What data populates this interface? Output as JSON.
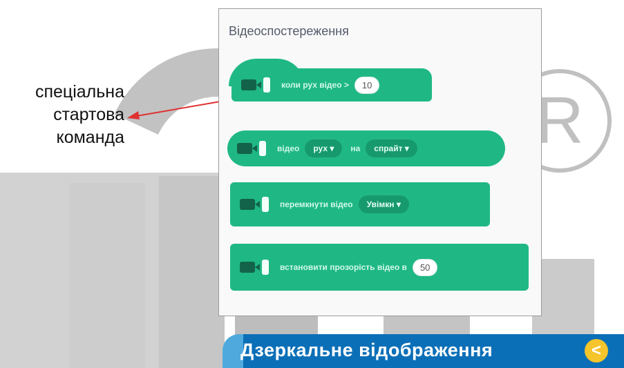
{
  "annotation": {
    "lines": [
      "спеціальна",
      "стартова",
      "команда"
    ],
    "arrow_color": "#e03131"
  },
  "panel": {
    "title": "Відеоспостереження",
    "blocks": [
      {
        "label": "коли рух відео >",
        "value": "10"
      },
      {
        "label_before": "відео",
        "dropdown1": "рух ▾",
        "label_mid": "на",
        "dropdown2": "спрайт ▾"
      },
      {
        "label": "перемкнути відео",
        "dropdown": "Увімкн ▾"
      },
      {
        "label": "встановити прозорість відео в",
        "value": "50"
      }
    ],
    "block_color": "#1fb885"
  },
  "banner": {
    "text": "Дзеркальне відображення",
    "button_symbol": "<",
    "bg_color": "#0b6fb7",
    "button_color": "#f6c42b"
  }
}
